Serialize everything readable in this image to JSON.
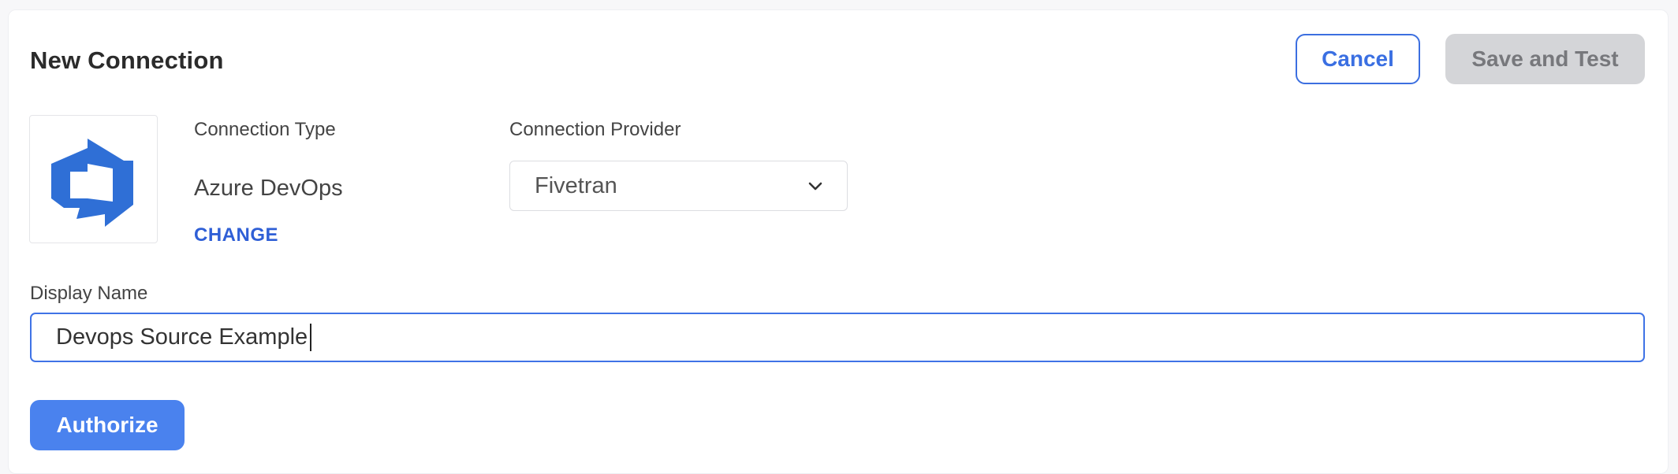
{
  "header": {
    "title": "New Connection",
    "cancel_label": "Cancel",
    "save_label": "Save and Test"
  },
  "connection_type": {
    "label": "Connection Type",
    "value": "Azure DevOps",
    "change_label": "CHANGE",
    "logo_icon": "azure-devops-logo-icon",
    "logo_color": "#2f6fd6"
  },
  "connection_provider": {
    "label": "Connection Provider",
    "selected": "Fivetran",
    "icon": "chevron-down-icon"
  },
  "display_name": {
    "label": "Display Name",
    "value": "Devops Source Example"
  },
  "actions": {
    "authorize_label": "Authorize"
  },
  "colors": {
    "accent": "#3f73e6",
    "primary_button": "#4a82ee",
    "disabled_button": "#d4d5d8",
    "link": "#2f5fd6"
  }
}
